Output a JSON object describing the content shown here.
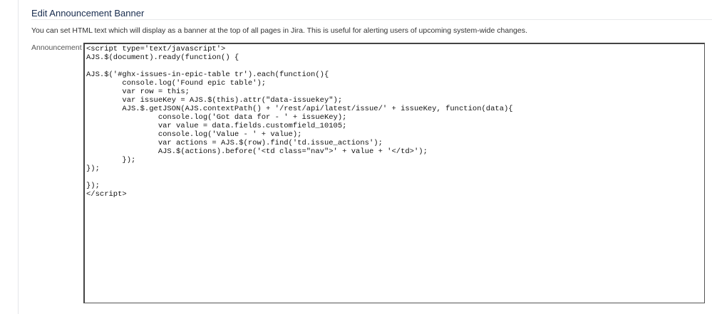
{
  "title": "Edit Announcement Banner",
  "description": "You can set HTML text which will display as a banner at the top of all pages in Jira. This is useful for alerting users of upcoming system-wide changes.",
  "announcement": {
    "label": "Announcement",
    "value": "<script type='text/javascript'>\nAJS.$(document).ready(function() {\n\nAJS.$('#ghx-issues-in-epic-table tr').each(function(){\n        console.log('Found epic table');\n        var row = this;\n        var issueKey = AJS.$(this).attr(\"data-issuekey\");\n        AJS.$.getJSON(AJS.contextPath() + '/rest/api/latest/issue/' + issueKey, function(data){\n                console.log('Got data for - ' + issueKey);\n                var value = data.fields.customfield_10105;\n                console.log('Value - ' + value);\n                var actions = AJS.$(row).find('td.issue_actions');\n                AJS.$(actions).before('<td class=\"nav\">' + value + '</td>');\n        });\n});\n\n});\n</script>"
  }
}
